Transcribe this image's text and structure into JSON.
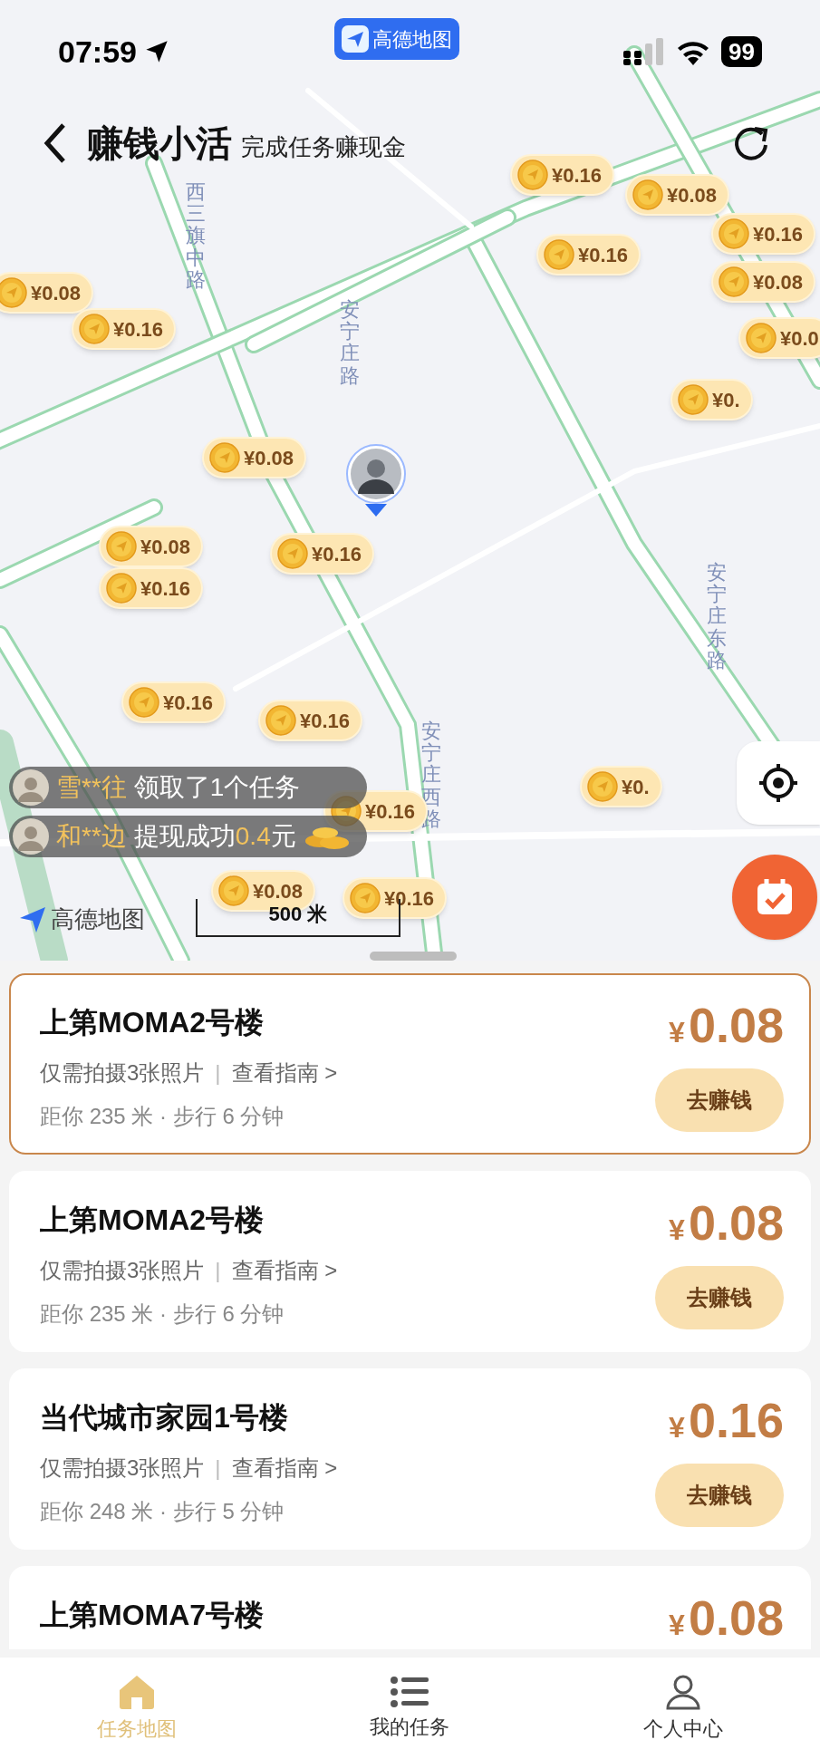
{
  "status_bar": {
    "time": "07:59",
    "app_pill": "高德地图",
    "battery": "99"
  },
  "header": {
    "title": "赚钱小活",
    "subtitle": "完成任务赚现金"
  },
  "map": {
    "road_labels": [
      "西三旗中路",
      "安宁庄路",
      "安宁庄东路",
      "安宁庄西路"
    ],
    "pins": [
      "¥0.16",
      "¥0.08",
      "¥0.16",
      "¥0.16",
      "¥0.08",
      "¥0.0",
      "¥0.",
      "¥0.08",
      "¥0.16",
      "¥0.08",
      "¥0.16",
      "¥0.08",
      "¥0.16",
      "¥0.16",
      "¥0.16",
      "¥0.",
      "¥0.16",
      "¥0.08",
      "¥0.16"
    ],
    "feed": [
      {
        "user": "雪**往",
        "text": "领取了1个任务",
        "coins": false
      },
      {
        "user": "和**边",
        "text": "提现成功",
        "amount": "0.4",
        "unit": "元",
        "coins": true
      }
    ],
    "logo": "高德地图",
    "scale": "500 米"
  },
  "tasks": [
    {
      "title": "上第MOMA2号楼",
      "note": "仅需拍摄3张照片",
      "separator": "|",
      "guide": "查看指南 >",
      "distance": "距你 235 米 · 步行 6 分钟",
      "currency": "¥",
      "price": "0.08",
      "button": "去赚钱",
      "selected": true
    },
    {
      "title": "上第MOMA2号楼",
      "note": "仅需拍摄3张照片",
      "separator": "|",
      "guide": "查看指南 >",
      "distance": "距你 235 米 · 步行 6 分钟",
      "currency": "¥",
      "price": "0.08",
      "button": "去赚钱",
      "selected": false
    },
    {
      "title": "当代城市家园1号楼",
      "note": "仅需拍摄3张照片",
      "separator": "|",
      "guide": "查看指南 >",
      "distance": "距你 248 米 · 步行 5 分钟",
      "currency": "¥",
      "price": "0.16",
      "button": "去赚钱",
      "selected": false
    },
    {
      "title": "上第MOMA7号楼",
      "currency": "¥",
      "price": "0.08",
      "selected": false
    }
  ],
  "nav": [
    {
      "label": "任务地图",
      "kind": "home",
      "selected": true
    },
    {
      "label": "我的任务",
      "kind": "list",
      "selected": false
    },
    {
      "label": "个人中心",
      "kind": "user",
      "selected": false
    }
  ]
}
